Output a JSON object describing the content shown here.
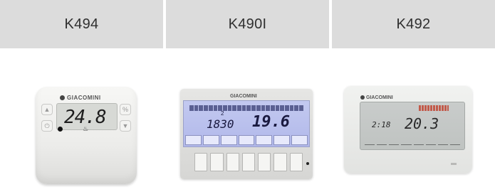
{
  "products": [
    {
      "model": "K494",
      "brand": "GIACOMINI",
      "display": {
        "temperature": "24.8"
      }
    },
    {
      "model": "K490I",
      "brand": "GIACOMINI",
      "display": {
        "time": "1830",
        "temperature": "19.6",
        "small": "2"
      }
    },
    {
      "model": "K492",
      "brand": "GIACOMINI",
      "display": {
        "time": "2:18",
        "temperature": "20.3"
      }
    }
  ],
  "colors": {
    "header_bg": "#dcdcdc",
    "k490i_lcd": "#b9bfee"
  },
  "icons": [
    "giacomini-logo-icon",
    "flame-icon",
    "led-icon"
  ]
}
